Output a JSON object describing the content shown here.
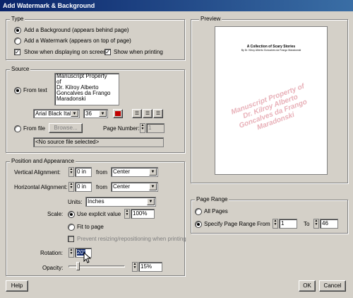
{
  "window": {
    "title": "Add Watermark & Background"
  },
  "type_group": {
    "label": "Type",
    "add_background": "Add a Background (appears behind page)",
    "add_watermark": "Add a Watermark (appears on top of page)",
    "show_screen": "Show when displaying on screen",
    "show_printing": "Show when printing",
    "selected": "background"
  },
  "source_group": {
    "label": "Source",
    "from_text": "From text",
    "text_lines": [
      "Manuscript Property",
      "of",
      "Dr. Kilroy Alberto",
      "Goncalves da Frango",
      "Maradonski"
    ],
    "font": "Arial Black Italic",
    "size": "36",
    "color": "#c00000",
    "from_file": "From file",
    "browse": "Browse...",
    "page_number_label": "Page Number:",
    "page_number_value": "1",
    "file_status": "<No source file selected>"
  },
  "position_group": {
    "label": "Position and Appearance",
    "vertical_label": "Vertical Alignment:",
    "vertical_value": "0 in",
    "vertical_from": "from",
    "vertical_anchor": "Center",
    "horizontal_label": "Horizontal Alignment:",
    "horizontal_value": "0 in",
    "horizontal_from": "from",
    "horizontal_anchor": "Center",
    "units_label": "Units:",
    "units_value": "Inches",
    "scale_label": "Scale:",
    "use_explicit": "Use explicit value",
    "scale_value": "100%",
    "fit_to_page": "Fit to page",
    "prevent_resizing": "Prevent resizing/repositioning when printing",
    "rotation_label": "Rotation:",
    "rotation_value": "20°",
    "opacity_label": "Opacity:",
    "opacity_value": "15%",
    "opacity_fraction": 0.15
  },
  "preview_group": {
    "label": "Preview",
    "doc_title": "A Collection of Scary Stories",
    "doc_subtitle": "By Dr. Kilroy Alberto Goncalves da Frango Maradonski",
    "watermark_lines": [
      "Manuscript Property of",
      "Dr. Kilroy Alberto",
      "Goncalves da Frango",
      "Maradonski"
    ]
  },
  "page_range_group": {
    "label": "Page Range",
    "all_pages": "All Pages",
    "specify": "Specify Page Range",
    "from_label": "From",
    "from_value": "1",
    "to_label": "To",
    "to_value": "46"
  },
  "buttons": {
    "help": "Help",
    "ok": "OK",
    "cancel": "Cancel"
  }
}
